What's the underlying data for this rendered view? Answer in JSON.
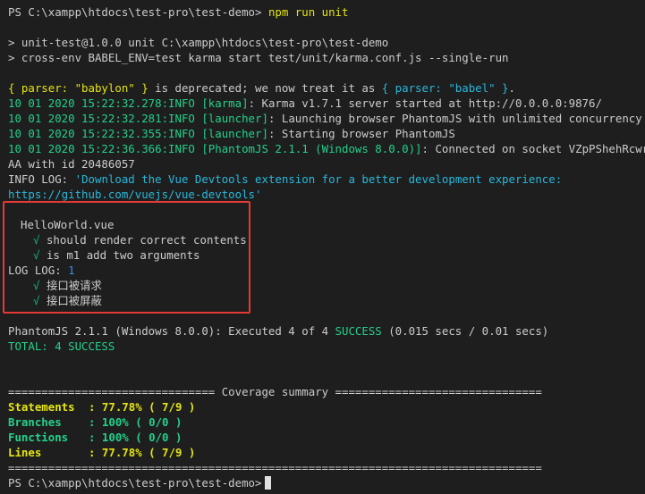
{
  "prompt": {
    "path": "PS C:\\xampp\\htdocs\\test-pro\\test-demo>",
    "command": "npm run unit"
  },
  "npm_header": {
    "line1": "> unit-test@1.0.0 unit C:\\xampp\\htdocs\\test-pro\\test-demo",
    "line2": "> cross-env BABEL_ENV=test karma start test/unit/karma.conf.js --single-run"
  },
  "deprecation": {
    "part1": "{ parser: \"babylon\" }",
    "part2": " is deprecated; we now treat it as ",
    "part3": "{ parser: \"babel\" }",
    "part4": "."
  },
  "logs": [
    {
      "ts": "10 01 2020 15:22:32.278:INFO",
      "tag": "[karma]",
      "msg": ": Karma v1.7.1 server started at http://0.0.0.0:9876/"
    },
    {
      "ts": "10 01 2020 15:22:32.281:INFO",
      "tag": "[launcher]",
      "msg": ": Launching browser PhantomJS with unlimited concurrency"
    },
    {
      "ts": "10 01 2020 15:22:32.355:INFO",
      "tag": "[launcher]",
      "msg": ": Starting browser PhantomJS"
    },
    {
      "ts": "10 01 2020 15:22:36.366:INFO",
      "tag": "[PhantomJS 2.1.1 (Windows 8.0.0)]",
      "msg": ": Connected on socket VZpPShehRcwrokO-AA"
    }
  ],
  "socket_cont": "AA with id 20486057",
  "info_log": {
    "prefix": "INFO LOG: ",
    "msg": "'Download the Vue Devtools extension for a better development experience:",
    "url": "https://github.com/vuejs/vue-devtools'"
  },
  "tests": {
    "suite": "HelloWorld.vue",
    "check": "√",
    "t1": "should render correct contents",
    "t2": "is m1 add two arguments",
    "log_label": "LOG LOG: ",
    "log_value": "1",
    "t3": "接口被请求",
    "t4": "接口被屏蔽"
  },
  "result": {
    "prefix": "PhantomJS 2.1.1 (Windows 8.0.0): Executed 4 of 4 ",
    "success": "SUCCESS",
    "suffix": " (0.015 secs / 0.01 secs)",
    "total": "TOTAL: 4 SUCCESS"
  },
  "coverage": {
    "header": "=============================== Coverage summary ===============================",
    "rows": [
      {
        "label": "Statements",
        "value": ": 77.78% ( 7/9 )"
      },
      {
        "label": "Branches",
        "value": ": 100% ( 0/0 )"
      },
      {
        "label": "Functions",
        "value": ": 100% ( 0/0 )"
      },
      {
        "label": "Lines",
        "value": ": 77.78% ( 7/9 )"
      }
    ],
    "footer": "================================================================================"
  },
  "final_prompt": "PS C:\\xampp\\htdocs\\test-pro\\test-demo>",
  "colors": {
    "background": "#1e1e1e",
    "default": "#cccccc",
    "yellow": "#e5e510",
    "green": "#23d18b",
    "cyan": "#29b8db",
    "highlight_border": "#e53935"
  }
}
